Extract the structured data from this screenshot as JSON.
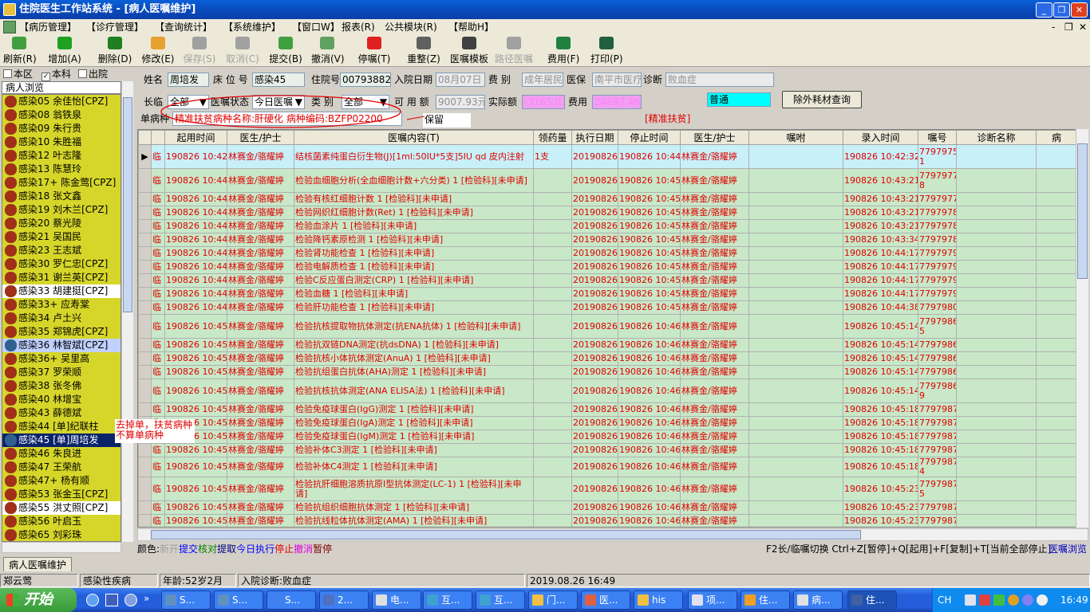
{
  "window": {
    "title": "住院医生工作站系统 - [病人医嘱维护]",
    "buttons": [
      "_",
      "❐",
      "✕"
    ]
  },
  "menu": [
    "【病历管理】",
    "【诊疗管理】",
    "【查询统计】",
    "【系统维护】",
    "【窗口W】",
    "报表(R)",
    "公共模块(R)",
    "【帮助H】"
  ],
  "mdi_buttons": [
    "-",
    "❐",
    "✕"
  ],
  "toolbar": [
    {
      "label": "刷新(R)",
      "color": "#40a040",
      "enabled": true
    },
    {
      "label": "增加(A)",
      "color": "#20a020",
      "enabled": true
    },
    {
      "label": "删除(D)",
      "color": "#208020",
      "enabled": true
    },
    {
      "label": "修改(E)",
      "color": "#e8a030",
      "enabled": true
    },
    {
      "label": "保存(S)",
      "color": "#a0a0a0",
      "enabled": false
    },
    {
      "label": "取消(C)",
      "color": "#a0a0a0",
      "enabled": false
    },
    {
      "label": "提交(B)",
      "color": "#40a040",
      "enabled": true
    },
    {
      "label": "撤消(V)",
      "color": "#60a060",
      "enabled": true
    },
    {
      "label": "停嘱(T)",
      "color": "#e02020",
      "enabled": true
    },
    {
      "label": "重整(Z)",
      "color": "#606060",
      "enabled": true
    },
    {
      "label": "医嘱模板",
      "color": "#404040",
      "enabled": true
    },
    {
      "label": "路径医嘱",
      "color": "#a0a0a0",
      "enabled": false
    },
    {
      "label": "费用(F)",
      "color": "#208040",
      "enabled": true
    },
    {
      "label": "打印(P)",
      "color": "#206040",
      "enabled": true
    }
  ],
  "left": {
    "filters": [
      {
        "label": "本区",
        "checked": false
      },
      {
        "label": "本科",
        "checked": true
      },
      {
        "label": "出院",
        "checked": false
      }
    ],
    "list_title": "病人浏览",
    "patients": [
      {
        "text": "感染05 余佳怡[CPZ]",
        "bg": "y"
      },
      {
        "text": "感染08 翁铁泉",
        "bg": "y"
      },
      {
        "text": "感染09 朱行贵",
        "bg": "y"
      },
      {
        "text": "感染10 朱胜福",
        "bg": "y"
      },
      {
        "text": "感染12 叶志隆",
        "bg": "y"
      },
      {
        "text": "感染13 陈慧玲",
        "bg": "y"
      },
      {
        "text": "感染17+ 陈金莺[CPZ]",
        "bg": "y"
      },
      {
        "text": "感染18 张文鑫",
        "bg": "y"
      },
      {
        "text": "感染19 刘木兰[CPZ]",
        "bg": "y"
      },
      {
        "text": "感染20 蔡光陵",
        "bg": "y"
      },
      {
        "text": "感染21 吴国民",
        "bg": "y"
      },
      {
        "text": "感染23 王志斌",
        "bg": "y"
      },
      {
        "text": "感染30 罗仁忠[CPZ]",
        "bg": "y"
      },
      {
        "text": "感染31 谢兰英[CPZ]",
        "bg": "y"
      },
      {
        "text": "感染33 胡建挺[CPZ]",
        "bg": "w"
      },
      {
        "text": "感染33+ 应寿棠",
        "bg": "y"
      },
      {
        "text": "感染34 卢土兴",
        "bg": "y"
      },
      {
        "text": "感染35 郑锦虎[CPZ]",
        "bg": "y"
      },
      {
        "text": "感染36 林智斌[CPZ]",
        "bg": "s"
      },
      {
        "text": "感染36+ 吴里高",
        "bg": "y"
      },
      {
        "text": "感染37 罗荣顺",
        "bg": "y"
      },
      {
        "text": "感染38 张冬佛",
        "bg": "y"
      },
      {
        "text": "感染40 林增宝",
        "bg": "y"
      },
      {
        "text": "感染43 薛德斌",
        "bg": "y"
      },
      {
        "text": "感染44 [单]纪联柱",
        "bg": "y"
      },
      {
        "text": "感染45 [单]周培发",
        "bg": "c"
      },
      {
        "text": "感染46 朱良进",
        "bg": "y"
      },
      {
        "text": "感染47 王荣航",
        "bg": "y"
      },
      {
        "text": "感染47+ 杨有顺",
        "bg": "y"
      },
      {
        "text": "感染53 张金玉[CPZ]",
        "bg": "y"
      },
      {
        "text": "感染55 洪丈照[CPZ]",
        "bg": "w"
      },
      {
        "text": "感染56 叶启玉",
        "bg": "y"
      },
      {
        "text": "感染65 刘彩珠",
        "bg": "y"
      }
    ]
  },
  "header": {
    "name_label": "姓名",
    "name": "周培发",
    "bed_label": "床 位 号",
    "bed": "感染45",
    "inpatient_label": "住院号",
    "inpatient": "00793882",
    "admit_label": "入院日期",
    "admit": "08月07日",
    "fee_label": "费 别",
    "fee": "成年居民",
    "insurance_label": "医保",
    "insurance": "南平市医疗",
    "diag_label": "诊断",
    "diag": "败血症",
    "longterm_label": "长临",
    "longterm": "全部",
    "status_label": "医嘱状态",
    "status": "今日医嘱",
    "type_label": "类 别",
    "type": "全部",
    "usable_label": "可 用 额",
    "usable": "9007.93元",
    "actual_label": "实际额",
    "actual": "-3165.07",
    "cost_label": "费用",
    "cost": "24697.46元",
    "level": "普通",
    "consumable_btn": "除外耗材查询",
    "disease_label": "单病种",
    "disease": "精准扶贫病种名称:肝硬化 病种编码:BZFP02200",
    "keep_note": "保留",
    "tag": "[精准扶贫]"
  },
  "grid": {
    "columns": [
      "起用时间",
      "医生/护士",
      "医嘱内容(T)",
      "领药量",
      "执行日期",
      "停止时间",
      "医生/护士",
      "嘱咐",
      "录入时间",
      "嘱号",
      "诊断名称",
      "病"
    ],
    "rows": [
      {
        "type": "临",
        "start": "190826 10:42",
        "doc": "林赛金/骆耀婷",
        "content": "结核菌素纯蛋白衍生物(J)[1ml:50IU*5支]5IU qd 皮内注射",
        "qty": "1支",
        "exec": "20190826",
        "stop": "190826 10:44",
        "doc2": "林赛金/骆耀婷",
        "input": "190826 10:42:32",
        "no": "7797975 1",
        "tall": true,
        "style": "b",
        "cur": true
      },
      {
        "type": "临",
        "start": "190826 10:44",
        "doc": "林赛金/骆耀婷",
        "content": "检验血细胞分析(全血细胞计数+六分类) 1 [检验科][未申请]",
        "qty": "",
        "exec": "20190826",
        "stop": "190826 10:45",
        "doc2": "林赛金/骆耀婷",
        "input": "190826 10:43:21",
        "no": "7797977 8",
        "tall": true,
        "style": "g"
      },
      {
        "type": "临",
        "start": "190826 10:44",
        "doc": "林赛金/骆耀婷",
        "content": "检验有核红细胞计数 1 [检验科][未申请]",
        "qty": "",
        "exec": "20190826",
        "stop": "190826 10:45",
        "doc2": "林赛金/骆耀婷",
        "input": "190826 10:43:21",
        "no": "7797977S",
        "style": "g"
      },
      {
        "type": "临",
        "start": "190826 10:44",
        "doc": "林赛金/骆耀婷",
        "content": "检验网织红细胞计数(Ret) 1 [检验科][未申请]",
        "qty": "",
        "exec": "20190826",
        "stop": "190826 10:45",
        "doc2": "林赛金/骆耀婷",
        "input": "190826 10:43:21",
        "no": "7797978C",
        "style": "g"
      },
      {
        "type": "临",
        "start": "190826 10:44",
        "doc": "林赛金/骆耀婷",
        "content": "检验血涂片 1 [检验科][未申请]",
        "qty": "",
        "exec": "20190826",
        "stop": "190826 10:45",
        "doc2": "林赛金/骆耀婷",
        "input": "190826 10:43:21",
        "no": "7797978l",
        "style": "g"
      },
      {
        "type": "临",
        "start": "190826 10:44",
        "doc": "林赛金/骆耀婷",
        "content": "检验降钙素原检测 1 [检验科][未申请]",
        "qty": "",
        "exec": "20190826",
        "stop": "190826 10:45",
        "doc2": "林赛金/骆耀婷",
        "input": "190826 10:43:34",
        "no": "7797978C",
        "style": "g"
      },
      {
        "type": "临",
        "start": "190826 10:44",
        "doc": "林赛金/骆耀婷",
        "content": "检验肾功能检查 1 [检验科][未申请]",
        "qty": "",
        "exec": "20190826",
        "stop": "190826 10:45",
        "doc2": "林赛金/骆耀婷",
        "input": "190826 10:44:17",
        "no": "7797979C",
        "style": "g"
      },
      {
        "type": "临",
        "start": "190826 10:44",
        "doc": "林赛金/骆耀婷",
        "content": "检验电解质检查 1 [检验科][未申请]",
        "qty": "",
        "exec": "20190826",
        "stop": "190826 10:45",
        "doc2": "林赛金/骆耀婷",
        "input": "190826 10:44:17",
        "no": "7797979Z",
        "style": "g"
      },
      {
        "type": "临",
        "start": "190826 10:44",
        "doc": "林赛金/骆耀婷",
        "content": "检验C反应蛋白测定(CRP) 1 [检验科][未申请]",
        "qty": "",
        "exec": "20190826",
        "stop": "190826 10:45",
        "doc2": "林赛金/骆耀婷",
        "input": "190826 10:44:17",
        "no": "7797979S",
        "style": "g"
      },
      {
        "type": "临",
        "start": "190826 10:44",
        "doc": "林赛金/骆耀婷",
        "content": "检验血糖 1 [检验科][未申请]",
        "qty": "",
        "exec": "20190826",
        "stop": "190826 10:45",
        "doc2": "林赛金/骆耀婷",
        "input": "190826 10:44:17",
        "no": "7797979E",
        "style": "g"
      },
      {
        "type": "临",
        "start": "190826 10:44",
        "doc": "林赛金/骆耀婷",
        "content": "检验肝功能检查 1 [检验科][未申请]",
        "qty": "",
        "exec": "20190826",
        "stop": "190826 10:45",
        "doc2": "林赛金/骆耀婷",
        "input": "190826 10:44:38",
        "no": "7797980S",
        "style": "g"
      },
      {
        "type": "临",
        "start": "190826 10:45",
        "doc": "林赛金/骆耀婷",
        "content": "检验抗核提取物抗体测定(抗ENA抗体) 1 [检验科][未申请]",
        "qty": "",
        "exec": "20190826",
        "stop": "190826 10:46",
        "doc2": "林赛金/骆耀婷",
        "input": "190826 10:45:14",
        "no": "7797986 5",
        "tall": true,
        "style": "g"
      },
      {
        "type": "临",
        "start": "190826 10:45",
        "doc": "林赛金/骆耀婷",
        "content": "检验抗双链DNA测定(抗dsDNA) 1 [检验科][未申请]",
        "qty": "",
        "exec": "20190826",
        "stop": "190826 10:46",
        "doc2": "林赛金/骆耀婷",
        "input": "190826 10:45:14",
        "no": "7797986E",
        "style": "g"
      },
      {
        "type": "临",
        "start": "190826 10:45",
        "doc": "林赛金/骆耀婷",
        "content": "检验抗核小体抗体测定(AnuA) 1 [检验科][未申请]",
        "qty": "",
        "exec": "20190826",
        "stop": "190826 10:46",
        "doc2": "林赛金/骆耀婷",
        "input": "190826 10:45:14",
        "no": "7797986T",
        "style": "g"
      },
      {
        "type": "临",
        "start": "190826 10:45",
        "doc": "林赛金/骆耀婷",
        "content": "检验抗组蛋白抗体(AHA)测定 1 [检验科][未申请]",
        "qty": "",
        "exec": "20190826",
        "stop": "190826 10:46",
        "doc2": "林赛金/骆耀婷",
        "input": "190826 10:45:14",
        "no": "7797986E",
        "style": "g"
      },
      {
        "type": "临",
        "start": "190826 10:45",
        "doc": "林赛金/骆耀婷",
        "content": "检验抗核抗体测定(ANA ELISA法) 1 [检验科][未申请]",
        "qty": "",
        "exec": "20190826",
        "stop": "190826 10:46",
        "doc2": "林赛金/骆耀婷",
        "input": "190826 10:45:14",
        "no": "7797986 9",
        "tall": true,
        "style": "g"
      },
      {
        "type": "临",
        "start": "190826 10:45",
        "doc": "林赛金/骆耀婷",
        "content": "检验免疫球蛋白(IgG)测定 1 [检验科][未申请]",
        "qty": "",
        "exec": "20190826",
        "stop": "190826 10:46",
        "doc2": "林赛金/骆耀婷",
        "input": "190826 10:45:18",
        "no": "7797987C",
        "style": "g"
      },
      {
        "type": "临",
        "start": "190826 10:45",
        "doc": "林赛金/骆耀婷",
        "content": "检验免疫球蛋白(IgA)测定 1 [检验科][未申请]",
        "qty": "",
        "exec": "20190826",
        "stop": "190826 10:46",
        "doc2": "林赛金/骆耀婷",
        "input": "190826 10:45:18",
        "no": "7797987l",
        "style": "g"
      },
      {
        "type": "临",
        "start": "190826 10:45",
        "doc": "林赛金/骆耀婷",
        "content": "检验免疫球蛋白(IgM)测定 1 [检验科][未申请]",
        "qty": "",
        "exec": "20190826",
        "stop": "190826 10:46",
        "doc2": "林赛金/骆耀婷",
        "input": "190826 10:45:18",
        "no": "7797987Z",
        "style": "g"
      },
      {
        "type": "临",
        "start": "190826 10:45",
        "doc": "林赛金/骆耀婷",
        "content": "检验补体C3测定 1 [检验科][未申请]",
        "qty": "",
        "exec": "20190826",
        "stop": "190826 10:46",
        "doc2": "林赛金/骆耀婷",
        "input": "190826 10:45:18",
        "no": "7797987E",
        "style": "g"
      },
      {
        "type": "临",
        "start": "190826 10:45",
        "doc": "林赛金/骆耀婷",
        "content": "检验补体C4测定 1 [检验科][未申请]",
        "qty": "",
        "exec": "20190826",
        "stop": "190826 10:46",
        "doc2": "林赛金/骆耀婷",
        "input": "190826 10:45:18",
        "no": "7797987 4",
        "style": "g"
      },
      {
        "type": "临",
        "start": "190826 10:45",
        "doc": "林赛金/骆耀婷",
        "content": "检验抗肝细胞溶质抗原I型抗体测定(LC-1) 1 [检验科][未申请]",
        "qty": "",
        "exec": "20190826",
        "stop": "190826 10:46",
        "doc2": "林赛金/骆耀婷",
        "input": "190826 10:45:23",
        "no": "7797987 5",
        "tall": true,
        "style": "g"
      },
      {
        "type": "临",
        "start": "190826 10:45",
        "doc": "林赛金/骆耀婷",
        "content": "检验抗组织细胞抗体测定 1 [检验科][未申请]",
        "qty": "",
        "exec": "20190826",
        "stop": "190826 10:46",
        "doc2": "林赛金/骆耀婷",
        "input": "190826 10:45:23",
        "no": "7797987E",
        "style": "g"
      },
      {
        "type": "临",
        "start": "190826 10:45",
        "doc": "林赛金/骆耀婷",
        "content": "检验抗线粒体抗体测定(AMA) 1 [检验科][未申请]",
        "qty": "",
        "exec": "20190826",
        "stop": "190826 10:46",
        "doc2": "林赛金/骆耀婷",
        "input": "190826 10:45:23",
        "no": "7797987T",
        "style": "g"
      }
    ]
  },
  "annotation": "去掉单，扶贫病种不算单病种",
  "legend": {
    "prefix": "颜色:",
    "items": [
      {
        "t": "新开",
        "c": "#a0a0a0"
      },
      {
        "t": "提交",
        "c": "#0000ff"
      },
      {
        "t": "核对",
        "c": "#008000"
      },
      {
        "t": "提取",
        "c": "#000080"
      },
      {
        "t": "今日执行",
        "c": "#0000ff"
      },
      {
        "t": "停止",
        "c": "#e00000"
      },
      {
        "t": "撤消",
        "c": "#e000e0"
      },
      {
        "t": "暂停",
        "c": "#800000"
      }
    ],
    "shortcuts": "F2长/临嘱切换 Ctrl+Z[暂停]+Q[起用]+F[复制]+T[当前全部停止]",
    "browse": "医嘱浏览"
  },
  "tab": "病人医嘱维护",
  "status": {
    "user": "郑云莺",
    "dept": "感染性疾病",
    "age": "年龄:52岁2月",
    "diag": "入院诊断:败血症",
    "datetime": "2019.08.26 16:49"
  },
  "taskbar": {
    "start": "开始",
    "tasks": [
      "S...",
      "S...",
      "S...",
      "2...",
      "电...",
      "互...",
      "互...",
      "门...",
      "医...",
      "his",
      "项...",
      "住...",
      "病...",
      "住..."
    ],
    "ime": "CH",
    "clock": "16:49"
  }
}
